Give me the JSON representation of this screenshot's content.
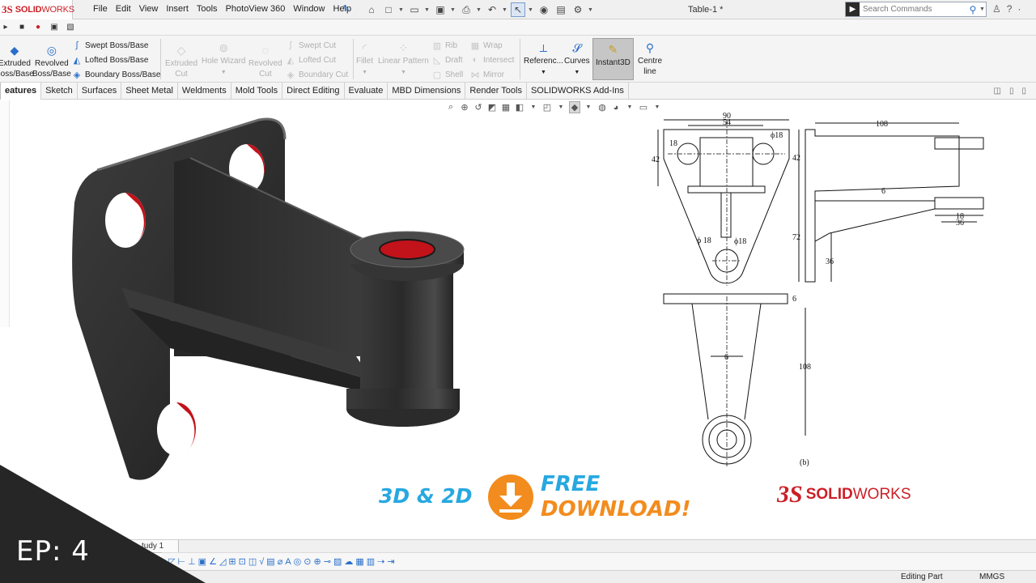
{
  "brand": {
    "ds": "3S",
    "name_bold": "SOLID",
    "name_light": "WORKS"
  },
  "menu": [
    "File",
    "Edit",
    "View",
    "Insert",
    "Tools",
    "PhotoView 360",
    "Window",
    "Help"
  ],
  "document_title": "Table-1 *",
  "search": {
    "placeholder": "Search Commands"
  },
  "ribbon": {
    "extruded": [
      "Extruded",
      "Boss/Base"
    ],
    "revolved": [
      "Revolved",
      "Boss/Base"
    ],
    "swept": "Swept Boss/Base",
    "lofted": "Lofted Boss/Base",
    "boundary": "Boundary Boss/Base",
    "extruded_cut": [
      "Extruded",
      "Cut"
    ],
    "hole_wizard": "Hole Wizard",
    "revolved_cut": [
      "Revolved",
      "Cut"
    ],
    "swept_cut": "Swept Cut",
    "lofted_cut": "Lofted Cut",
    "boundary_cut": "Boundary Cut",
    "fillet": "Fillet",
    "linear_pattern": "Linear Pattern",
    "rib": "Rib",
    "draft": "Draft",
    "shell": "Shell",
    "wrap": "Wrap",
    "intersect": "Intersect",
    "mirror": "Mirror",
    "reference": "Referenc...",
    "curves": "Curves",
    "instant3d": "Instant3D",
    "centre_line": [
      "Centre",
      "line"
    ]
  },
  "tabs": [
    "eatures",
    "Sketch",
    "Surfaces",
    "Sheet Metal",
    "Weldments",
    "Mold Tools",
    "Direct Editing",
    "Evaluate",
    "MBD Dimensions",
    "Render Tools",
    "SOLIDWORKS Add-Ins"
  ],
  "drawing": {
    "dims": {
      "d90": "90",
      "d54": "54",
      "d18_top": "18",
      "phi18_a": "ϕ18",
      "d42_left": "42",
      "phi18_b": "ϕ 18",
      "phi18_c": "ϕ18",
      "d108_top": "108",
      "d42_right": "42",
      "d6_mid": "6",
      "d72": "72",
      "d18_side": "18",
      "d36_side": "36",
      "d36_vert": "36",
      "d6_plate": "6",
      "d6_rib": "6",
      "d108_vert": "108",
      "caption": "(b)"
    }
  },
  "promo": {
    "left": "3D & 2D",
    "free": "FREE",
    "download": "DOWNLOAD!"
  },
  "brand_promo": {
    "ds": "3S",
    "bold": "SOLID",
    "light": "WORKS"
  },
  "bottom": {
    "study_tab": "tudy 1"
  },
  "status": {
    "mode": "Editing Part",
    "units": "MMGS"
  },
  "episode": "EP: 4",
  "colors": {
    "accent_red": "#cc1f26",
    "promo_blue": "#27a8e0",
    "promo_orange": "#f28c1e",
    "part": "#2e2e2e",
    "hole": "#c2121a"
  }
}
